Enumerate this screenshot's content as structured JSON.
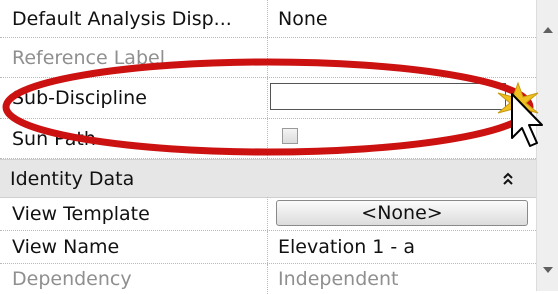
{
  "properties": {
    "rows": [
      {
        "label": "Default Analysis Disp...",
        "value": "None"
      },
      {
        "label": "Reference Label",
        "value": ""
      },
      {
        "label": "Sub-Discipline",
        "value": ""
      },
      {
        "label": "Sun Path",
        "value": ""
      }
    ],
    "group": {
      "label": "Identity Data",
      "collapse_icon": "double-chevron-up-icon"
    },
    "identity_rows": [
      {
        "label": "View Template",
        "value": "<None>"
      },
      {
        "label": "View Name",
        "value": "Elevation 1 - a"
      },
      {
        "label": "Dependency",
        "value": "Independent"
      }
    ]
  },
  "annotation": {
    "highlight_color": "#cc1111",
    "spark_color": "#f0c020"
  },
  "icons": {
    "pointer": "mouse-pointer-icon",
    "spark": "click-spark-icon"
  }
}
